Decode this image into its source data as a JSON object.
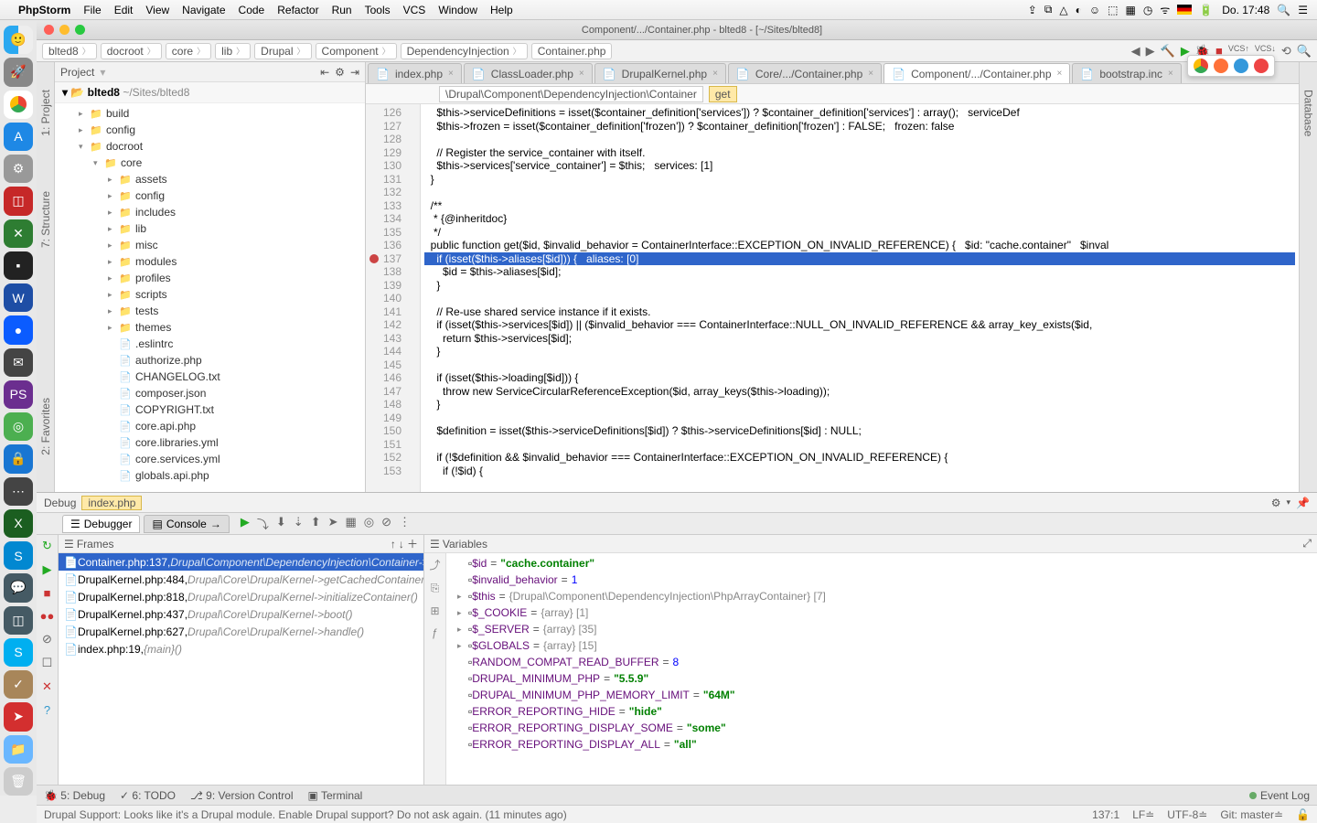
{
  "menubar": {
    "app": "PhpStorm",
    "items": [
      "File",
      "Edit",
      "View",
      "Navigate",
      "Code",
      "Refactor",
      "Run",
      "Tools",
      "VCS",
      "Window",
      "Help"
    ],
    "clock": "Do. 17:48"
  },
  "window": {
    "title": "Component/.../Container.php - blted8 - [~/Sites/blted8]"
  },
  "breadcrumbs": [
    "blted8",
    "docroot",
    "core",
    "lib",
    "Drupal",
    "Component",
    "DependencyInjection",
    "Container.php"
  ],
  "project": {
    "label": "Project",
    "root": "blted8",
    "root_path": "~/Sites/blted8",
    "tree": [
      {
        "d": 1,
        "t": "folder",
        "n": "build",
        "exp": false
      },
      {
        "d": 1,
        "t": "folder",
        "n": "config",
        "exp": false
      },
      {
        "d": 1,
        "t": "folder",
        "n": "docroot",
        "exp": true
      },
      {
        "d": 2,
        "t": "folder",
        "n": "core",
        "exp": true
      },
      {
        "d": 3,
        "t": "folder",
        "n": "assets",
        "exp": false
      },
      {
        "d": 3,
        "t": "folder",
        "n": "config",
        "exp": false
      },
      {
        "d": 3,
        "t": "folder",
        "n": "includes",
        "exp": false
      },
      {
        "d": 3,
        "t": "folder",
        "n": "lib",
        "exp": false
      },
      {
        "d": 3,
        "t": "folder",
        "n": "misc",
        "exp": false
      },
      {
        "d": 3,
        "t": "folder",
        "n": "modules",
        "exp": false
      },
      {
        "d": 3,
        "t": "folder",
        "n": "profiles",
        "exp": false
      },
      {
        "d": 3,
        "t": "folder",
        "n": "scripts",
        "exp": false
      },
      {
        "d": 3,
        "t": "folder",
        "n": "tests",
        "exp": false
      },
      {
        "d": 3,
        "t": "folder",
        "n": "themes",
        "exp": false
      },
      {
        "d": 3,
        "t": "file",
        "n": ".eslintrc"
      },
      {
        "d": 3,
        "t": "file",
        "n": "authorize.php"
      },
      {
        "d": 3,
        "t": "file",
        "n": "CHANGELOG.txt"
      },
      {
        "d": 3,
        "t": "file",
        "n": "composer.json"
      },
      {
        "d": 3,
        "t": "file",
        "n": "COPYRIGHT.txt"
      },
      {
        "d": 3,
        "t": "file",
        "n": "core.api.php"
      },
      {
        "d": 3,
        "t": "file",
        "n": "core.libraries.yml"
      },
      {
        "d": 3,
        "t": "file",
        "n": "core.services.yml"
      },
      {
        "d": 3,
        "t": "file",
        "n": "globals.api.php"
      }
    ]
  },
  "editor": {
    "tabs": [
      {
        "label": "index.php"
      },
      {
        "label": "ClassLoader.php"
      },
      {
        "label": "DrupalKernel.php"
      },
      {
        "label": "Core/.../Container.php"
      },
      {
        "label": "Component/.../Container.php",
        "active": true
      },
      {
        "label": "bootstrap.inc"
      }
    ],
    "crumb_namespace": "\\Drupal\\Component\\DependencyInjection\\Container",
    "crumb_method": "get",
    "first_line": 126,
    "highlight_line": 137,
    "breakpoint_line": 137,
    "lines": [
      "    $this->serviceDefinitions = isset($container_definition['services']) ? $container_definition['services'] : array();   serviceDef",
      "    $this->frozen = isset($container_definition['frozen']) ? $container_definition['frozen'] : FALSE;   frozen: false",
      "",
      "    // Register the service_container with itself.",
      "    $this->services['service_container'] = $this;   services: [1]",
      "  }",
      "",
      "  /**",
      "   * {@inheritdoc}",
      "   */",
      "  public function get($id, $invalid_behavior = ContainerInterface::EXCEPTION_ON_INVALID_REFERENCE) {   $id: \"cache.container\"   $inval",
      "    if (isset($this->aliases[$id])) {   aliases: [0]",
      "      $id = $this->aliases[$id];",
      "    }",
      "",
      "    // Re-use shared service instance if it exists.",
      "    if (isset($this->services[$id]) || ($invalid_behavior === ContainerInterface::NULL_ON_INVALID_REFERENCE && array_key_exists($id,",
      "      return $this->services[$id];",
      "    }",
      "",
      "    if (isset($this->loading[$id])) {",
      "      throw new ServiceCircularReferenceException($id, array_keys($this->loading));",
      "    }",
      "",
      "    $definition = isset($this->serviceDefinitions[$id]) ? $this->serviceDefinitions[$id] : NULL;",
      "",
      "    if (!$definition && $invalid_behavior === ContainerInterface::EXCEPTION_ON_INVALID_REFERENCE) {",
      "      if (!$id) {"
    ]
  },
  "debug": {
    "title": "Debug",
    "session": "index.php",
    "tabs": {
      "debugger": "Debugger",
      "console": "Console"
    },
    "frames_label": "Frames",
    "vars_label": "Variables",
    "frames": [
      {
        "loc": "Container.php:137,",
        "cls": "Drupal\\Component\\DependencyInjection\\Container->get()",
        "sel": true
      },
      {
        "loc": "DrupalKernel.php:484,",
        "cls": "Drupal\\Core\\DrupalKernel->getCachedContainerDefinition()"
      },
      {
        "loc": "DrupalKernel.php:818,",
        "cls": "Drupal\\Core\\DrupalKernel->initializeContainer()"
      },
      {
        "loc": "DrupalKernel.php:437,",
        "cls": "Drupal\\Core\\DrupalKernel->boot()"
      },
      {
        "loc": "DrupalKernel.php:627,",
        "cls": "Drupal\\Core\\DrupalKernel->handle()"
      },
      {
        "loc": "index.php:19,",
        "cls": "{main}()"
      }
    ],
    "vars": [
      {
        "tw": "",
        "nm": "$id",
        "eq": " = ",
        "val": "\"cache.container\"",
        "typ": "s"
      },
      {
        "tw": "",
        "nm": "$invalid_behavior",
        "eq": " = ",
        "val": "1",
        "typ": "n"
      },
      {
        "tw": "▸",
        "nm": "$this",
        "eq": " = ",
        "val": "{Drupal\\Component\\DependencyInjection\\PhpArrayContainer} [7]",
        "typ": "o"
      },
      {
        "tw": "▸",
        "nm": "$_COOKIE",
        "eq": " = ",
        "val": "{array} [1]",
        "typ": "o"
      },
      {
        "tw": "▸",
        "nm": "$_SERVER",
        "eq": " = ",
        "val": "{array} [35]",
        "typ": "o"
      },
      {
        "tw": "▸",
        "nm": "$GLOBALS",
        "eq": " = ",
        "val": "{array} [15]",
        "typ": "o"
      },
      {
        "tw": "",
        "nm": "RANDOM_COMPAT_READ_BUFFER",
        "eq": " = ",
        "val": "8",
        "typ": "n"
      },
      {
        "tw": "",
        "nm": "DRUPAL_MINIMUM_PHP",
        "eq": " = ",
        "val": "\"5.5.9\"",
        "typ": "s"
      },
      {
        "tw": "",
        "nm": "DRUPAL_MINIMUM_PHP_MEMORY_LIMIT",
        "eq": " = ",
        "val": "\"64M\"",
        "typ": "s"
      },
      {
        "tw": "",
        "nm": "ERROR_REPORTING_HIDE",
        "eq": " = ",
        "val": "\"hide\"",
        "typ": "s"
      },
      {
        "tw": "",
        "nm": "ERROR_REPORTING_DISPLAY_SOME",
        "eq": " = ",
        "val": "\"some\"",
        "typ": "s"
      },
      {
        "tw": "",
        "nm": "ERROR_REPORTING_DISPLAY_ALL",
        "eq": " = ",
        "val": "\"all\"",
        "typ": "s"
      }
    ]
  },
  "bottom_tabs": {
    "debug": "5: Debug",
    "todo": "6: TODO",
    "vcs": "9: Version Control",
    "terminal": "Terminal",
    "event_log": "Event Log"
  },
  "statusbar": {
    "msg": "Drupal Support: Looks like it's a Drupal module. Enable Drupal support? Do not ask again. (11 minutes ago)",
    "pos": "137:1",
    "lf": "LF≐",
    "enc": "UTF-8≐",
    "git": "Git: master≐"
  },
  "side_labels": {
    "project": "1: Project",
    "structure": "7: Structure",
    "favorites": "2: Favorites",
    "database": "Database"
  }
}
